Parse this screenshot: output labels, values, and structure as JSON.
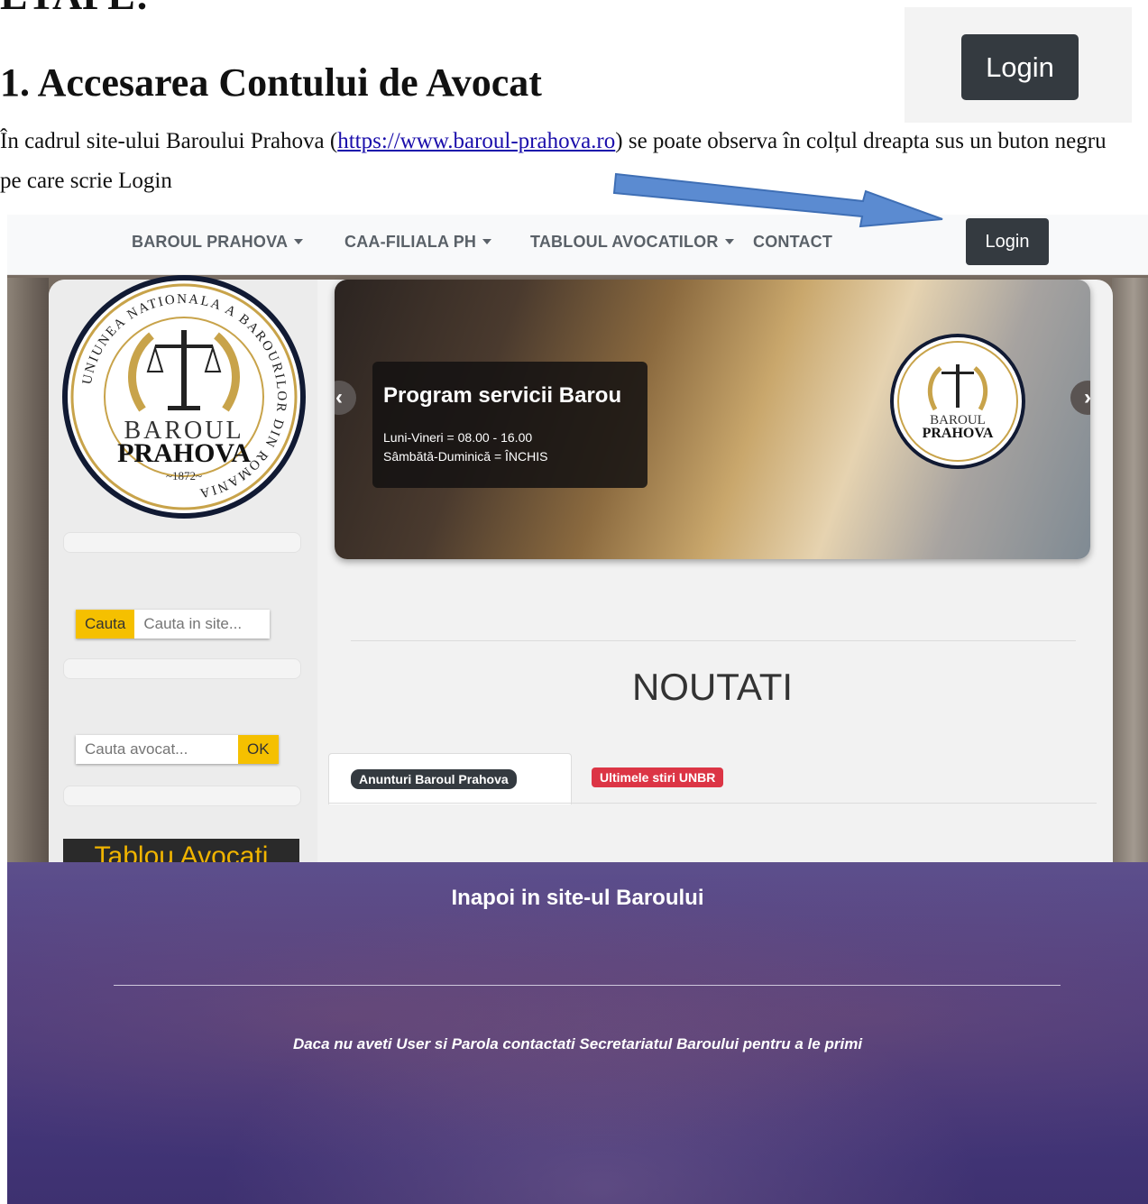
{
  "document": {
    "heading_cut": "ETAPE:",
    "heading": "1. Accesarea Contului de Avocat",
    "para_before_link": "În cadrul site-ului Baroului Prahova (",
    "link_text": "https://www.baroul-prahova.ro",
    "para_after_link": ") se poate observa în colțul dreapta sus un buton negru pe care scrie Login",
    "login_snippet_label": "Login"
  },
  "site": {
    "nav": {
      "items": [
        "BAROUL PRAHOVA",
        "CAA-FILIALA PH",
        "TABLOUL AVOCATILOR",
        "CONTACT"
      ],
      "login": "Login"
    },
    "logo": {
      "ring_text": "UNIUNEA NATIONALA A BAROURILOR DIN ROMANIA",
      "line1": "BAROUL",
      "line2": "PRAHOVA",
      "year": "~1872~"
    },
    "search": {
      "button": "Cauta",
      "placeholder": "Cauta in site..."
    },
    "lawyer_search": {
      "placeholder": "Cauta avocat...",
      "button": "OK"
    },
    "tablou_banner": "Tablou Avocati",
    "slide": {
      "title": "Program servicii Barou",
      "line1": "Luni-Vineri = 08.00 - 16.00",
      "line2": "Sâmbătă-Duminică = ÎNCHIS",
      "prev": "‹",
      "next": "›"
    },
    "news_heading": "NOUTATI",
    "tabs": [
      "Anunturi Baroul Prahova",
      "Ultimele stiri UNBR"
    ],
    "footer": {
      "title": "Inapoi in site-ul Baroului",
      "note": "Daca nu aveti User si Parola contactati Secretariatul Baroului pentru a le primi"
    }
  },
  "colors": {
    "arrow": "#5b8bd1",
    "login_button": "#343a40",
    "search_accent": "#f5c000",
    "badge_red": "#dc3545",
    "footer_purple": "#4e3f83"
  }
}
